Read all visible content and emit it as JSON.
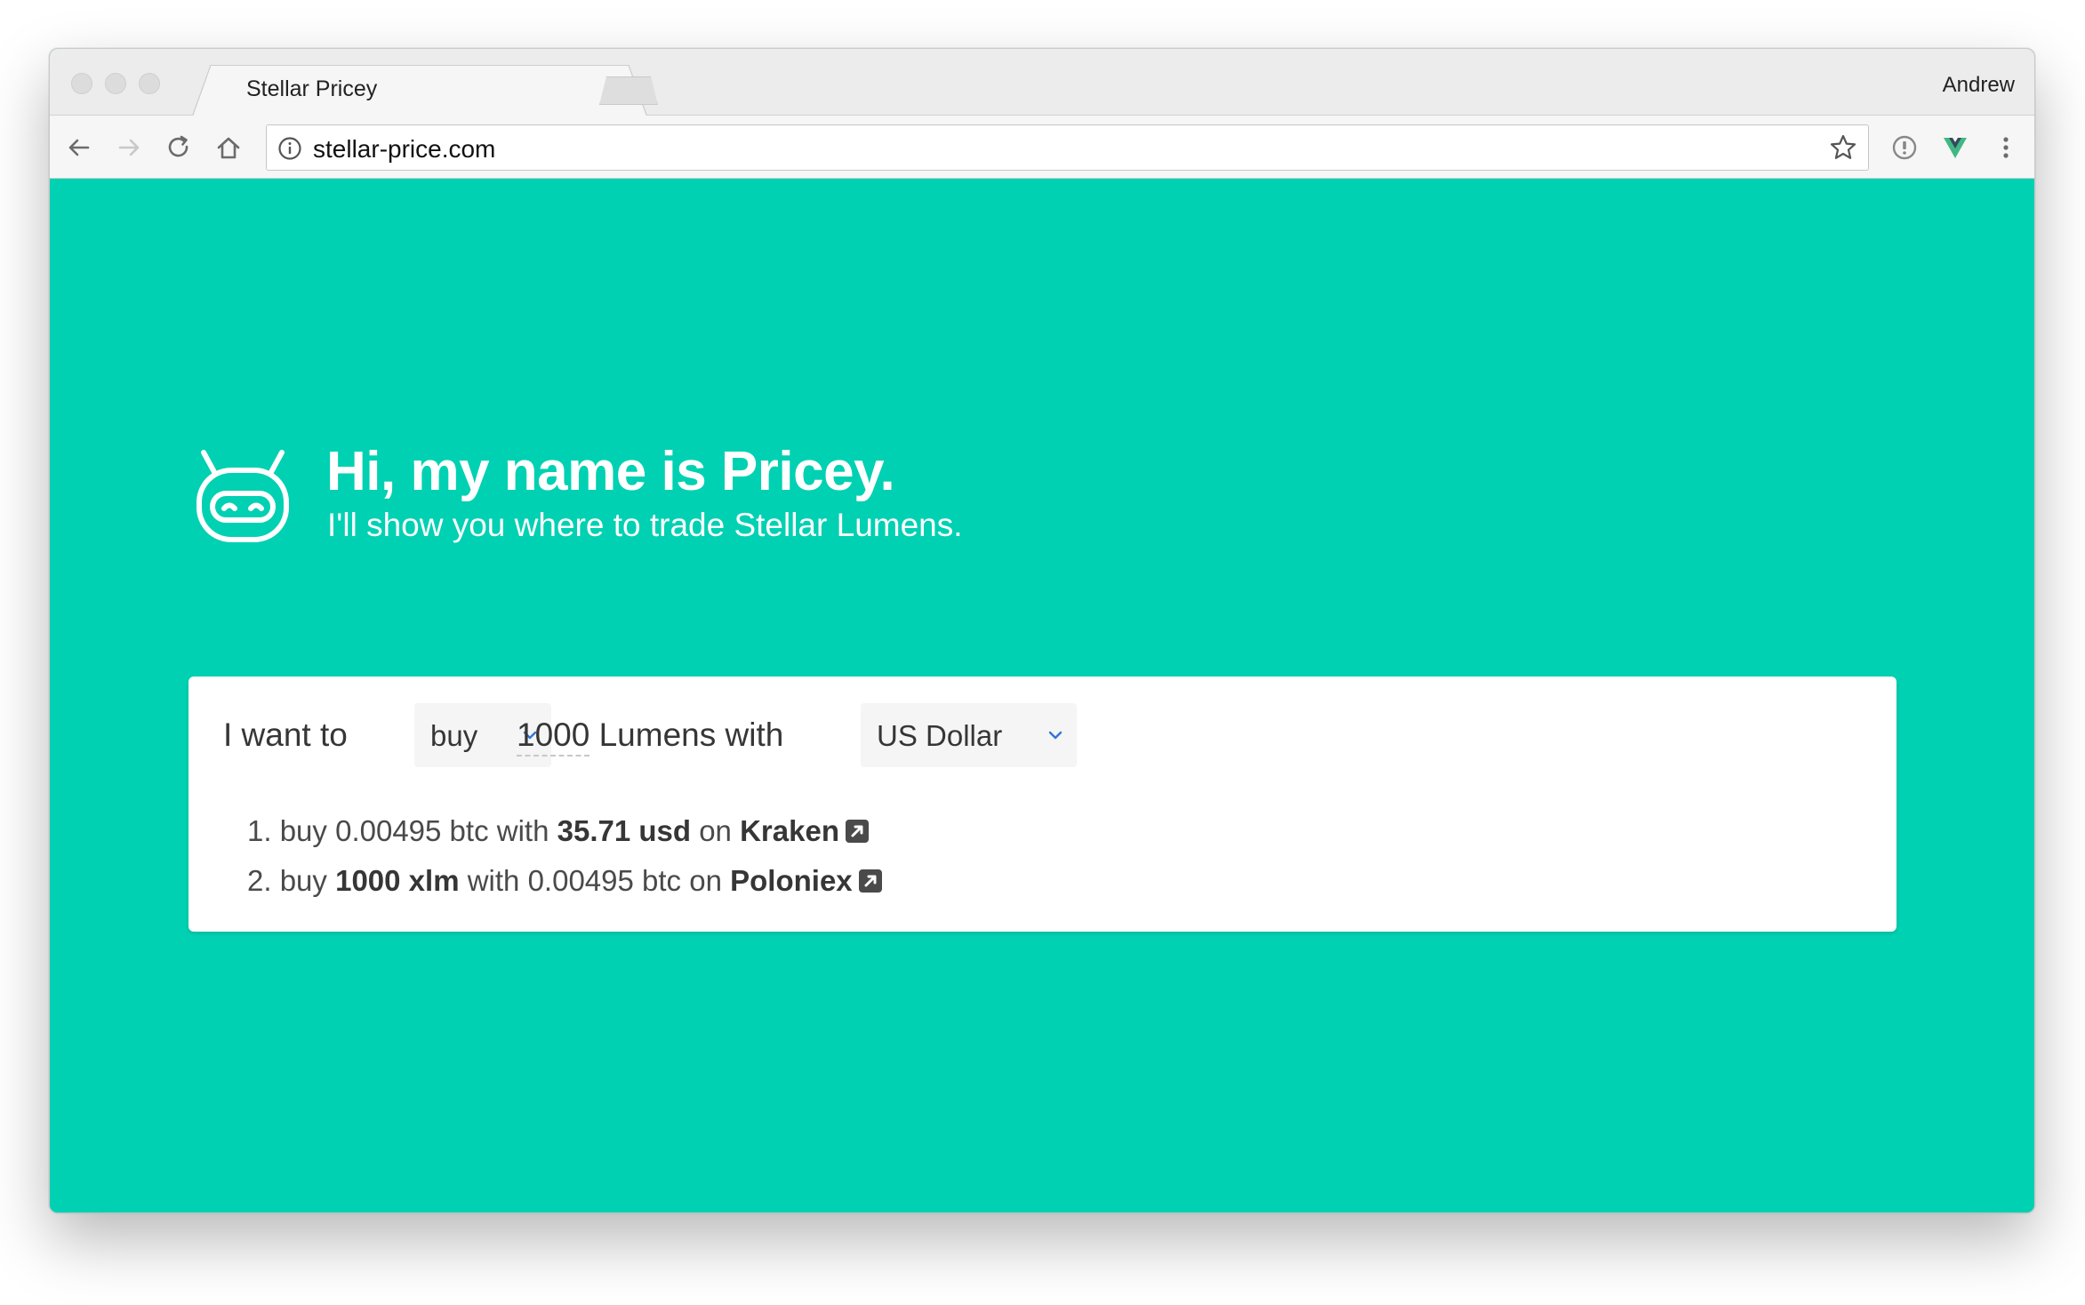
{
  "browser": {
    "tab_title": "Stellar Pricey",
    "tab_close": "×",
    "profile_name": "Andrew",
    "url": "stellar-price.com"
  },
  "hero": {
    "title": "Hi, my name is Pricey.",
    "subtitle": "I'll show you where to trade Stellar Lumens."
  },
  "form": {
    "prefix": "I want to",
    "action": "buy",
    "amount": "1000",
    "amount_suffix": "Lumens with",
    "currency": "US Dollar"
  },
  "steps": [
    {
      "number": "1.",
      "verb": "buy",
      "give": "0.00495 btc",
      "with": "with",
      "receive": "35.71 usd",
      "on": "on",
      "exchange": "Kraken"
    },
    {
      "number": "2.",
      "verb": "buy",
      "give": "1000 xlm",
      "with": "with",
      "receive": "0.00495 btc",
      "on": "on",
      "exchange": "Poloniex"
    }
  ],
  "colors": {
    "page_background": "#00d1b2",
    "card_background": "#ffffff",
    "text": "#363636",
    "select_chevron": "#3273dc"
  },
  "icons": {
    "hero": "robot-icon",
    "external_link": "external-link-icon",
    "back": "back-arrow-icon",
    "forward": "forward-arrow-icon",
    "reload": "reload-icon",
    "home": "home-icon",
    "info": "info-icon",
    "bookmark": "star-icon",
    "extension_1": "password-manager-icon",
    "extension_2": "vue-devtools-icon",
    "menu": "more-vert-icon"
  }
}
